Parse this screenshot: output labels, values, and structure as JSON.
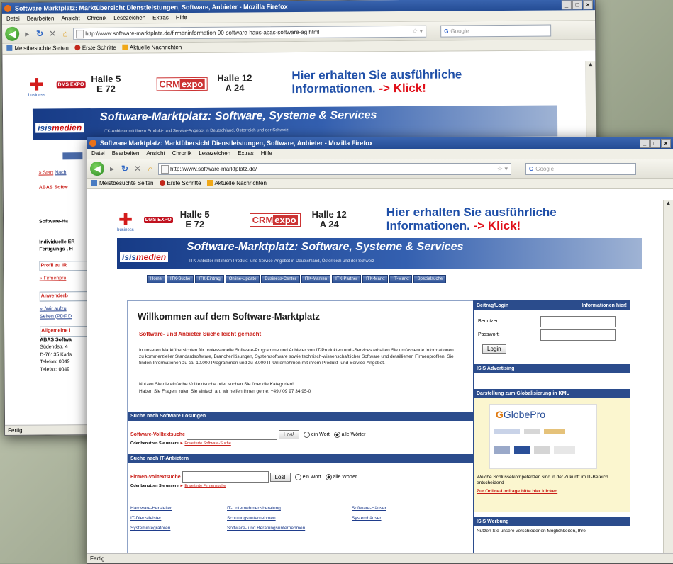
{
  "back_window": {
    "title": "Software Marktplatz: Marktübersicht Dienstleistungen, Software, Anbieter - Mozilla Firefox",
    "menu": [
      "Datei",
      "Bearbeiten",
      "Ansicht",
      "Chronik",
      "Lesezeichen",
      "Extras",
      "Hilfe"
    ],
    "url": "http://www.software-marktplatz.de/firmeninformation-90-software-haus-abas-software-ag.html",
    "search_placeholder": "Google",
    "bookmarks": [
      "Meistbesuchte Seiten",
      "Erste Schritte",
      "Aktuelle Nachrichten"
    ],
    "status": "Fertig",
    "page_fragments": [
      "» Start",
      "Nach",
      "ABAS Softw",
      "Software-Ha",
      "Individuelle ER",
      "Fertigungs-, H",
      "Profil zu IR",
      "» Firmenpro",
      "Anwenderb",
      "» „Wir aufzu",
      "Seiten (PDF D",
      "Allgemeine I",
      "ABAS Softwa",
      "Südendstr. 4",
      "D-76135 Karls",
      "Telefon: 0049",
      "Telefax: 0049"
    ]
  },
  "front_window": {
    "title": "Software Marktplatz: Marktübersicht Dienstleistungen, Software, Anbieter - Mozilla Firefox",
    "menu": [
      "Datei",
      "Bearbeiten",
      "Ansicht",
      "Chronik",
      "Lesezeichen",
      "Extras",
      "Hilfe"
    ],
    "url": "http://www.software-marktplatz.de/",
    "search_placeholder": "Google",
    "bookmarks": [
      "Meistbesuchte Seiten",
      "Erste Schritte",
      "Aktuelle Nachrichten"
    ],
    "status": "Fertig"
  },
  "ad": {
    "business_label": "business",
    "dms_label": "DMS EXPO",
    "hall1_line1": "Halle 5",
    "hall1_line2": "E 72",
    "crm_prefix": "CRM",
    "crm_suffix": "expo",
    "hall2_line1": "Halle 12",
    "hall2_line2": "A 24",
    "info_line1": "Hier erhalten Sie ausführliche",
    "info_line2": "Informationen.",
    "klick": "-> Klick!"
  },
  "banner": {
    "isis": "isis",
    "medien": "medien",
    "title": "Software-Marktplatz: Software, Systeme & Services",
    "subtitle": "ITK-Anbieter mit ihrem Produkt- und Service-Angebot in Deutschland, Österreich und der Schweiz"
  },
  "nav_items": [
    "Home",
    "ITK-Suche",
    "ITK-Eintrag",
    "Online-Update",
    "Business-Center",
    "ITK-Marken",
    "ITK-Partner",
    "ITK-Markt",
    "IT-Markt",
    "Spezialsuche"
  ],
  "main": {
    "welcome_title": "Willkommen auf dem Software-Marktplatz",
    "welcome_sub": "Software- und Anbieter Suche leicht gemacht",
    "intro": "In unseren Marktübersichten für professionelle Software-Programme und Anbieter von IT-Produkten und -Services erhalten Sie umfassende Informationen zu kommerzieller Standardsoftware, Branchenlösungen, Systemsoftware sowie technisch-wissenschaftlicher Software und detaillierten Firmenprofilen. Sie finden Informationen zu ca. 10.000 Programmen und zu 8.000 IT-Unternehmen mit ihrem Produkt- und Service-Angebot.",
    "hint1": "Nutzen Sie die einfache Volltextsuche oder suchen Sie über die Kategorien!",
    "hint2": "Haben Sie Fragen, rufen Sie einfach an, wir helfen Ihnen gerne: +49 / 09 97 34 95-0",
    "software_header": "Suche nach Software Lösungen",
    "software_label": "Software-Volltextsuche",
    "software_button": "Los!",
    "radio_any": "ein Wort",
    "radio_all": "alle Wörter",
    "software_alt": "Oder benutzen Sie unsere",
    "software_link": "Erweiterte Software-Suche",
    "anbieter_header": "Suche nach IT-Anbietern",
    "firmen_label": "Firmen-Volltextsuche",
    "firmen_button": "Los!",
    "firmen_alt": "Oder benutzen Sie unsere",
    "firmen_link": "Erweiterte Firmensuche",
    "cat_col1": [
      "Hardware-Hersteller",
      "IT-Dienstleister",
      "Systemintegratoren"
    ],
    "cat_col2": [
      "IT-Unternehmensberatung",
      "Schulungsunternehmen",
      "Software- und Beratungsunternehmen"
    ],
    "cat_col3": [
      "Software-Häuser",
      "Systemhäuser"
    ]
  },
  "sidebar": {
    "login_header": "Beitrag/Login",
    "login_info": "Informationen hier!",
    "user_label": "Benutzer:",
    "pass_label": "Passwort:",
    "login_button": "Login",
    "advertising_header": "ISIS Advertising",
    "globe_header": "Darstellung zum Globalisierung in KMU",
    "globe_logo": "GlobePro",
    "globe_text": "Welche Schlüsselkompetenzen sind in der Zukunft im IT-Bereich entscheidend",
    "globe_link": "Zur Online-Umfrage bitte hier klicken",
    "werbung_header": "ISIS Werbung",
    "werbung_text": "Nutzen Sie unsere verschiedenen Möglichkeiten, Ihre"
  }
}
